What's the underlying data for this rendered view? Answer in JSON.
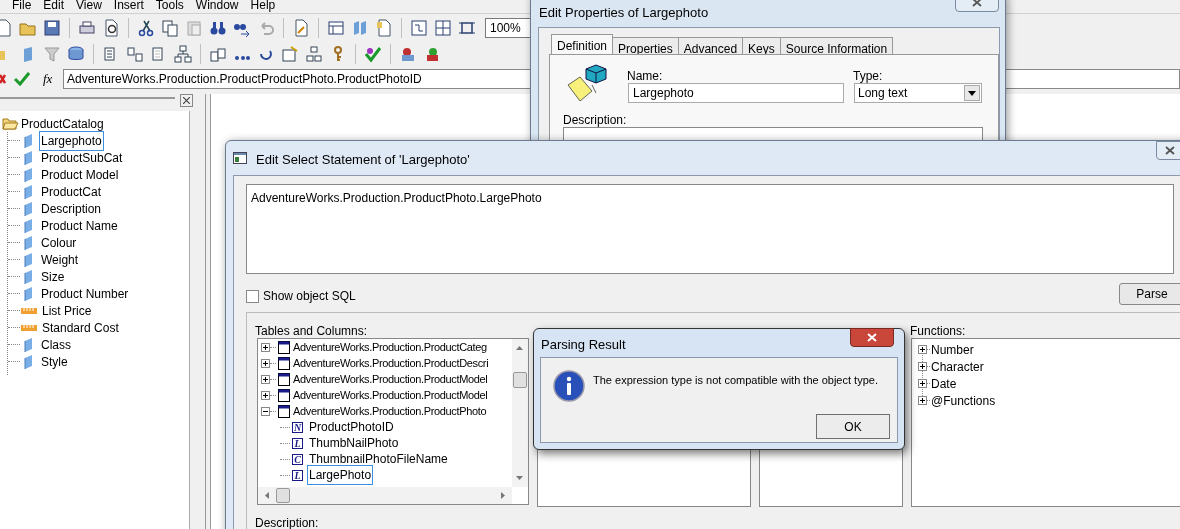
{
  "menu": [
    {
      "label": "File"
    },
    {
      "label": "Edit"
    },
    {
      "label": "View"
    },
    {
      "label": "Insert"
    },
    {
      "label": "Tools"
    },
    {
      "label": "Window"
    },
    {
      "label": "Help"
    }
  ],
  "zoom": {
    "value": "100%"
  },
  "formula_bar": {
    "fx_label": "fx",
    "value": "AdventureWorks.Production.ProductProductPhoto.ProductPhotoID"
  },
  "catalog_tree": {
    "label": "ProductCatalog",
    "expanded": true,
    "children": [
      {
        "label": "Largephoto",
        "kind": "dimension",
        "selected": true
      },
      {
        "label": "ProductSubCat",
        "kind": "dimension",
        "selected": false
      },
      {
        "label": "Product Model",
        "kind": "dimension",
        "selected": false
      },
      {
        "label": "ProductCat",
        "kind": "dimension",
        "selected": false
      },
      {
        "label": "Description",
        "kind": "dimension",
        "selected": false
      },
      {
        "label": "Product Name",
        "kind": "dimension",
        "selected": false
      },
      {
        "label": "Colour",
        "kind": "dimension",
        "selected": false
      },
      {
        "label": "Weight",
        "kind": "dimension",
        "selected": false
      },
      {
        "label": "Size",
        "kind": "dimension",
        "selected": false
      },
      {
        "label": "Product Number",
        "kind": "dimension",
        "selected": false
      },
      {
        "label": "List Price",
        "kind": "measure",
        "selected": false
      },
      {
        "label": "Standard Cost",
        "kind": "measure",
        "selected": false
      },
      {
        "label": "Class",
        "kind": "dimension",
        "selected": false
      },
      {
        "label": "Style",
        "kind": "dimension",
        "selected": false
      }
    ]
  },
  "properties_dialog": {
    "title": "Edit Properties of Largephoto",
    "tabs": [
      {
        "label": "Definition",
        "selected": true
      },
      {
        "label": "Properties",
        "selected": false
      },
      {
        "label": "Advanced",
        "selected": false
      },
      {
        "label": "Keys",
        "selected": false
      },
      {
        "label": "Source Information",
        "selected": false
      }
    ],
    "name_label": "Name:",
    "name_value": "Largephoto",
    "type_label": "Type:",
    "type_value": "Long text",
    "description_label": "Description:"
  },
  "select_dialog": {
    "title": "Edit Select Statement of 'Largephoto'",
    "statement": "AdventureWorks.Production.ProductPhoto.LargePhoto",
    "show_sql": {
      "label": "Show object SQL",
      "checked": false
    },
    "parse_button": "Parse",
    "tables_label": "Tables and Columns:",
    "tables": [
      {
        "label": "AdventureWorks.Production.ProductCateg",
        "expanded": false
      },
      {
        "label": "AdventureWorks.Production.ProductDescri",
        "expanded": false
      },
      {
        "label": "AdventureWorks.Production.ProductModel",
        "expanded": false
      },
      {
        "label": "AdventureWorks.Production.ProductModel",
        "expanded": false
      },
      {
        "label": "AdventureWorks.Production.ProductPhoto",
        "expanded": true,
        "children": [
          {
            "label": "ProductPhotoID",
            "type_letter": "N",
            "selected": false
          },
          {
            "label": "ThumbNailPhoto",
            "type_letter": "L",
            "selected": false
          },
          {
            "label": "ThumbnailPhotoFileName",
            "type_letter": "C",
            "selected": false
          },
          {
            "label": "LargePhoto",
            "type_letter": "L",
            "selected": true
          }
        ]
      }
    ],
    "functions_label": "Functions:",
    "functions": [
      {
        "label": "Number",
        "expanded": false
      },
      {
        "label": "Character",
        "expanded": false
      },
      {
        "label": "Date",
        "expanded": false
      },
      {
        "label": "@Functions",
        "expanded": false
      }
    ],
    "description_label": "Description:"
  },
  "message": {
    "title": "Parsing Result",
    "text": "The expression type is not compatible with the object type.",
    "ok_button": "OK"
  }
}
